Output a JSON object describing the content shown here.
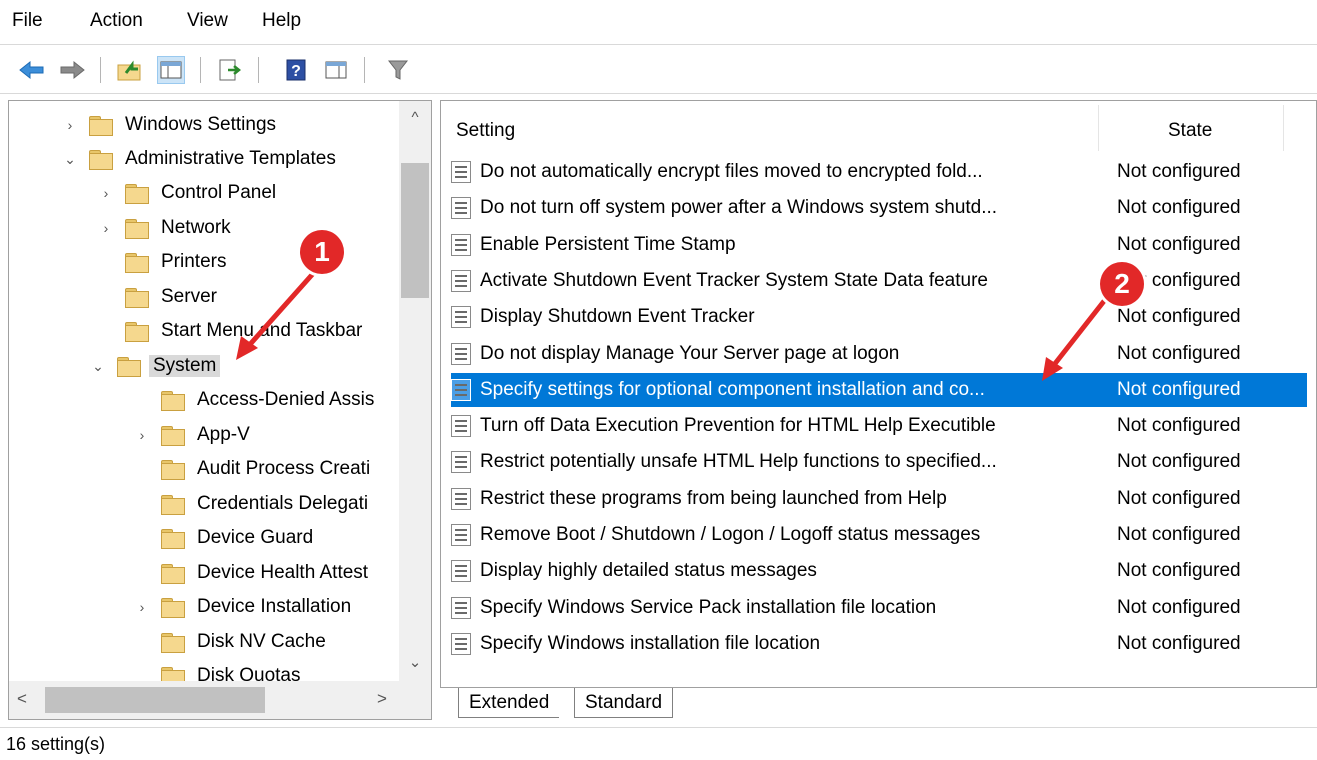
{
  "menu": {
    "file": "File",
    "action": "Action",
    "view": "View",
    "help": "Help"
  },
  "toolbar": {
    "icons": [
      "back-arrow-icon",
      "forward-arrow-icon",
      "up-folder-icon",
      "show-hide-tree-icon",
      "export-list-icon",
      "help-icon",
      "properties-icon",
      "filter-icon"
    ]
  },
  "tree": {
    "items": [
      {
        "label": "Windows Settings",
        "chevron": "›"
      },
      {
        "label": "Administrative Templates",
        "chevron": "⌄"
      },
      {
        "label": "Control Panel",
        "chevron": "›"
      },
      {
        "label": "Network",
        "chevron": "›"
      },
      {
        "label": "Printers",
        "chevron": ""
      },
      {
        "label": "Server",
        "chevron": ""
      },
      {
        "label": "Start Menu and Taskbar",
        "chevron": ""
      },
      {
        "label": "System",
        "chevron": "⌄"
      },
      {
        "label": "Access-Denied Assis",
        "chevron": ""
      },
      {
        "label": "App-V",
        "chevron": "›"
      },
      {
        "label": "Audit Process Creati",
        "chevron": ""
      },
      {
        "label": "Credentials Delegati",
        "chevron": ""
      },
      {
        "label": "Device Guard",
        "chevron": ""
      },
      {
        "label": "Device Health Attest",
        "chevron": ""
      },
      {
        "label": "Device Installation",
        "chevron": "›"
      },
      {
        "label": "Disk NV Cache",
        "chevron": ""
      },
      {
        "label": "Disk Quotas",
        "chevron": ""
      }
    ],
    "scroll_up": "^",
    "scroll_down": "⌄",
    "scroll_left": "<",
    "scroll_right": ">"
  },
  "list": {
    "col_setting": "Setting",
    "col_state": "State",
    "rows": [
      {
        "name": "Do not automatically encrypt files moved to encrypted fold...",
        "state": "Not configured"
      },
      {
        "name": "Do not turn off system power after a Windows system shutd...",
        "state": "Not configured"
      },
      {
        "name": "Enable Persistent Time Stamp",
        "state": "Not configured"
      },
      {
        "name": "Activate Shutdown Event Tracker System State Data feature",
        "state": "Not configured"
      },
      {
        "name": "Display Shutdown Event Tracker",
        "state": "Not configured"
      },
      {
        "name": "Do not display Manage Your Server page at logon",
        "state": "Not configured"
      },
      {
        "name": "Specify settings for optional component installation and co...",
        "state": "Not configured"
      },
      {
        "name": "Turn off Data Execution Prevention for HTML Help Executible",
        "state": "Not configured"
      },
      {
        "name": "Restrict potentially unsafe HTML Help functions to specified...",
        "state": "Not configured"
      },
      {
        "name": "Restrict these programs from being launched from Help",
        "state": "Not configured"
      },
      {
        "name": "Remove Boot / Shutdown / Logon / Logoff status messages",
        "state": "Not configured"
      },
      {
        "name": "Display highly detailed status messages",
        "state": "Not configured"
      },
      {
        "name": "Specify Windows Service Pack installation file location",
        "state": "Not configured"
      },
      {
        "name": "Specify Windows installation file location",
        "state": "Not configured"
      }
    ],
    "selected_index": 6
  },
  "tabs": {
    "extended": "Extended",
    "standard": "Standard"
  },
  "status": {
    "text": "16 setting(s)"
  },
  "annotations": {
    "badge1": "1",
    "badge2": "2",
    "color": "#e22828"
  }
}
